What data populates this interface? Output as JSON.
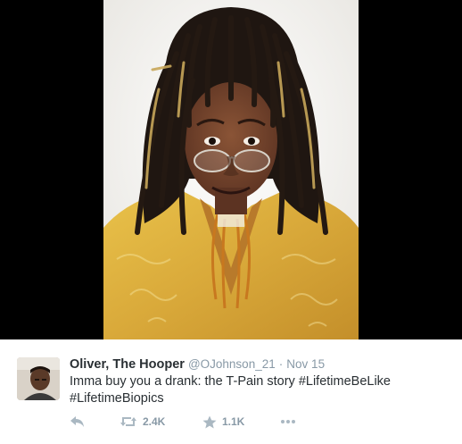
{
  "tweet": {
    "display_name": "Oliver, The Hooper",
    "handle": "@OJohnson_21",
    "separator": "·",
    "date": "Nov 15",
    "text_main": "Imma buy you a drank: the T-Pain story ",
    "hashtag_1": "#LifetimeBeLike",
    "hashtag_2": "#LifetimeBiopics"
  },
  "actions": {
    "reply_icon": "reply-arrow-icon",
    "retweet_icon": "retweet-icon",
    "retweet_count": "2.4K",
    "favorite_icon": "star-icon",
    "favorite_count": "1.1K",
    "more_icon": "ellipsis-icon"
  },
  "colors": {
    "text": "#292f33",
    "muted": "#8899a6",
    "action_icon": "#aab8c2",
    "media_background": "#000000"
  }
}
